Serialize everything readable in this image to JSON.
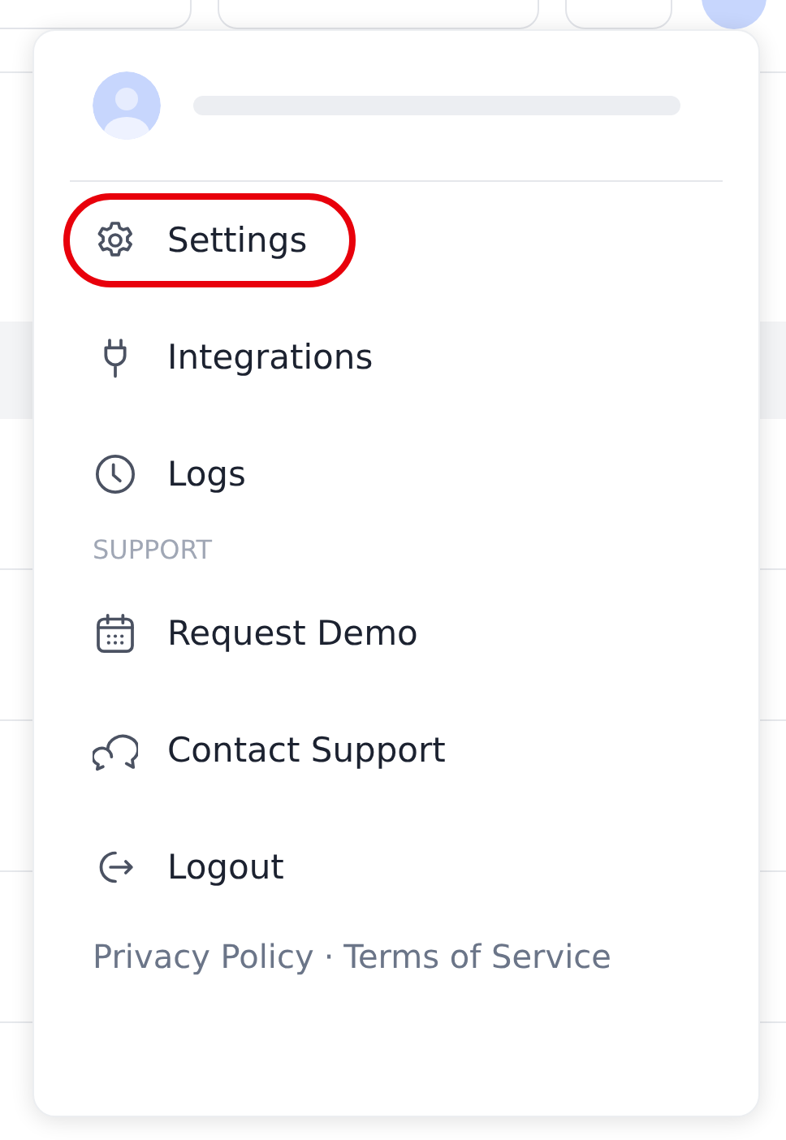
{
  "menu": [
    {
      "kind": "settings",
      "label": "Settings",
      "highlighted": true
    },
    {
      "kind": "integrations",
      "label": "Integrations",
      "highlighted": false
    },
    {
      "kind": "logs",
      "label": "Logs",
      "highlighted": false
    }
  ],
  "support": {
    "heading": "SUPPORT",
    "items": [
      {
        "kind": "demo",
        "label": "Request Demo",
        "highlighted": false
      },
      {
        "kind": "contact",
        "label": "Contact Support",
        "highlighted": false
      },
      {
        "kind": "logout",
        "label": "Logout",
        "highlighted": false
      }
    ]
  },
  "footer": {
    "links": [
      "Privacy Policy",
      "Terms of Service"
    ],
    "separator": "·"
  }
}
